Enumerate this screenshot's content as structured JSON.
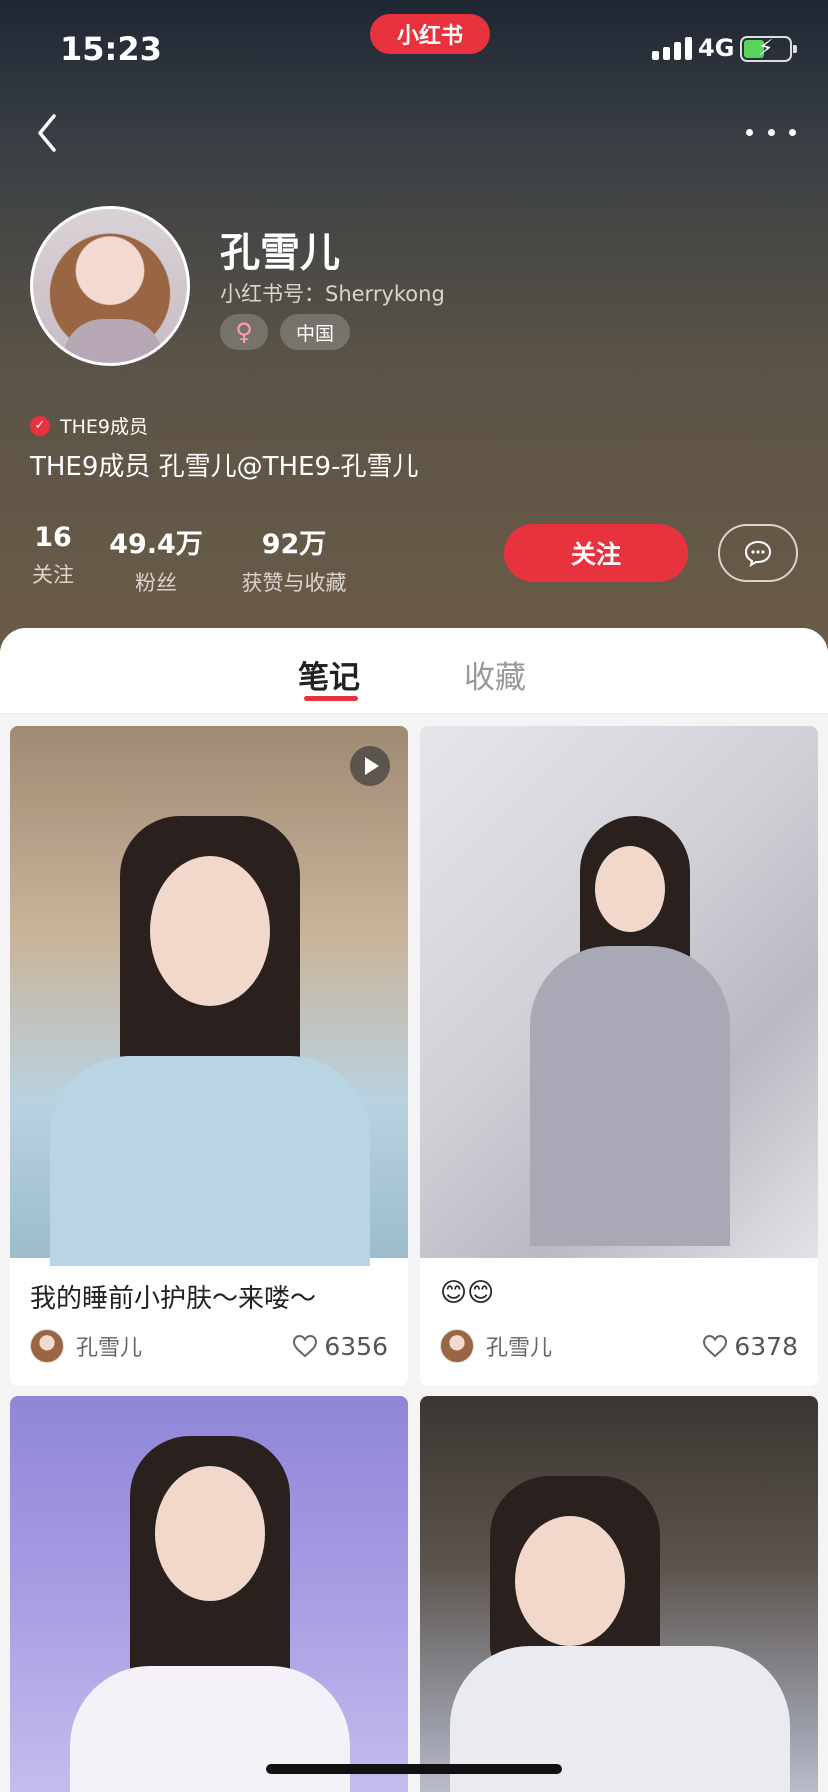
{
  "status_bar": {
    "time": "15:23",
    "app_badge": "小红书",
    "network": "4G"
  },
  "profile": {
    "name": "孔雪儿",
    "redid": "小红书号：Sherrykong",
    "gender_symbol": "♀",
    "region": "中国",
    "verify_label": "THE9成员",
    "bio": "THE9成员 孔雪儿@THE9-孔雪儿"
  },
  "stats": {
    "following": {
      "value": "16",
      "label": "关注"
    },
    "fans": {
      "value": "49.4万",
      "label": "粉丝"
    },
    "likes": {
      "value": "92万",
      "label": "获赞与收藏"
    }
  },
  "actions": {
    "follow_label": "关注"
  },
  "tabs": [
    {
      "label": "笔记"
    },
    {
      "label": "收藏"
    }
  ],
  "notes": [
    {
      "title": "我的睡前小护肤～来喽～",
      "author": "孔雪儿",
      "likes": "6356"
    },
    {
      "title": "😊😊",
      "author": "孔雪儿",
      "likes": "6378"
    }
  ],
  "colors": {
    "accent": "#e8333f"
  }
}
